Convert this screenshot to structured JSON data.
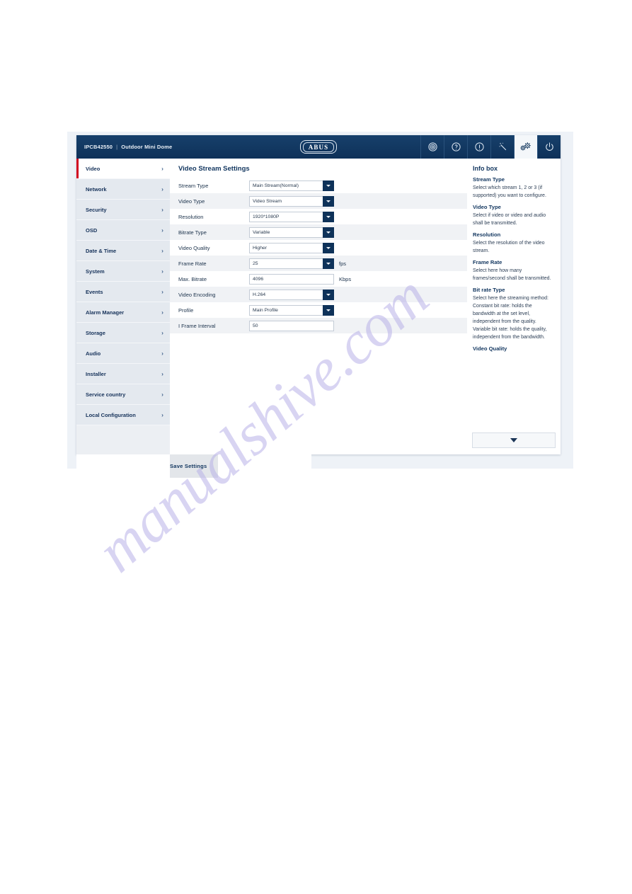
{
  "topbar": {
    "model": "IPCB42550",
    "separator": "|",
    "device_name": "Outdoor Mini Dome",
    "logo_text": "ABUS",
    "icons": [
      {
        "name": "live-view-icon",
        "label": "Live View"
      },
      {
        "name": "help-question-icon",
        "label": "Help"
      },
      {
        "name": "info-circle-icon",
        "label": "Info"
      },
      {
        "name": "magic-wand-icon",
        "label": "Wizard"
      },
      {
        "name": "gears-settings-icon",
        "label": "Settings",
        "active": true
      },
      {
        "name": "power-icon",
        "label": "Logout"
      }
    ]
  },
  "sidebar": {
    "items": [
      {
        "label": "Video",
        "active": true
      },
      {
        "label": "Network",
        "active": false
      },
      {
        "label": "Security",
        "active": false
      },
      {
        "label": "OSD",
        "active": false
      },
      {
        "label": "Date & Time",
        "active": false
      },
      {
        "label": "System",
        "active": false
      },
      {
        "label": "Events",
        "active": false
      },
      {
        "label": "Alarm Manager",
        "active": false
      },
      {
        "label": "Storage",
        "active": false
      },
      {
        "label": "Audio",
        "active": false
      },
      {
        "label": "Installer",
        "active": false
      },
      {
        "label": "Service country",
        "active": false
      },
      {
        "label": "Local Configuration",
        "active": false
      }
    ],
    "chevron": "›"
  },
  "main": {
    "title": "Video Stream Settings",
    "fields": [
      {
        "label": "Stream Type",
        "value": "Main Stream(Normal)",
        "type": "select",
        "unit": ""
      },
      {
        "label": "Video Type",
        "value": "Video Stream",
        "type": "select",
        "unit": ""
      },
      {
        "label": "Resolution",
        "value": "1920*1080P",
        "type": "select",
        "unit": ""
      },
      {
        "label": "Bitrate Type",
        "value": "Variable",
        "type": "select",
        "unit": ""
      },
      {
        "label": "Video Quality",
        "value": "Higher",
        "type": "select",
        "unit": ""
      },
      {
        "label": "Frame Rate",
        "value": "25",
        "type": "select",
        "unit": "fps"
      },
      {
        "label": "Max. Bitrate",
        "value": "4096",
        "type": "text",
        "unit": "Kbps"
      },
      {
        "label": "Video Encoding",
        "value": "H.264",
        "type": "select",
        "unit": ""
      },
      {
        "label": "Profile",
        "value": "Main Profile",
        "type": "select",
        "unit": ""
      },
      {
        "label": "I Frame Interval",
        "value": "50",
        "type": "text",
        "unit": ""
      }
    ]
  },
  "infobox": {
    "title": "Info box",
    "sections": [
      {
        "heading": "Stream Type",
        "body": "Select which stream 1, 2 or 3 (if supported) you want to configure."
      },
      {
        "heading": "Video Type",
        "body": "Select if video or video and audio shall be transmitted."
      },
      {
        "heading": "Resolution",
        "body": "Select the resolution of the video stream."
      },
      {
        "heading": "Frame Rate",
        "body": "Select here how many frames/second shall be transmitted."
      },
      {
        "heading": "Bit rate Type",
        "body": "Select here the streaming method: Constant bit rate: holds the bandwidth at the set level, independent from the quality. Variable bit rate: holds the quality, independent from the bandwidth."
      },
      {
        "heading": "Video Quality",
        "body": ""
      }
    ],
    "scroll_down_label": "Scroll down"
  },
  "footer": {
    "save_label": "Save Settings"
  },
  "watermark": {
    "text": "manualshive.com"
  },
  "colors": {
    "topbar_navy": "#0e3159",
    "accent_red": "#d1001f",
    "heading_navy": "#12365f",
    "dropdown_navy": "#0e3259",
    "sidebar_gray": "#e4e9ef",
    "footer_gray": "#e3e6ea",
    "stripe_gray": "#f0f2f5"
  }
}
